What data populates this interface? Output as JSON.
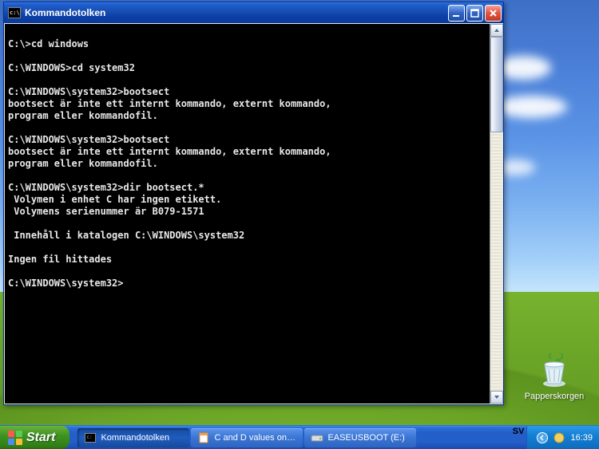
{
  "window": {
    "title": "Kommandotolken"
  },
  "terminal": {
    "lines": [
      "",
      "C:\\>cd windows",
      "",
      "C:\\WINDOWS>cd system32",
      "",
      "C:\\WINDOWS\\system32>bootsect",
      "bootsect är inte ett internt kommando, externt kommando,",
      "program eller kommandofil.",
      "",
      "C:\\WINDOWS\\system32>bootsect",
      "bootsect är inte ett internt kommando, externt kommando,",
      "program eller kommandofil.",
      "",
      "C:\\WINDOWS\\system32>dir bootsect.*",
      " Volymen i enhet C har ingen etikett.",
      " Volymens serienummer är B079-1571",
      "",
      " Innehåll i katalogen C:\\WINDOWS\\system32",
      "",
      "Ingen fil hittades",
      "",
      "C:\\WINDOWS\\system32>"
    ]
  },
  "desktop": {
    "recycle_bin_label": "Papperskorgen"
  },
  "taskbar": {
    "start_label": "Start",
    "items": [
      {
        "label": "Kommandotolken",
        "icon": "terminal",
        "active": true
      },
      {
        "label": "C and D values on RE...",
        "icon": "browser",
        "active": false
      },
      {
        "label": "EASEUSBOOT (E:)",
        "icon": "drive",
        "active": false
      }
    ],
    "lang": "SV",
    "clock": "16:39"
  }
}
